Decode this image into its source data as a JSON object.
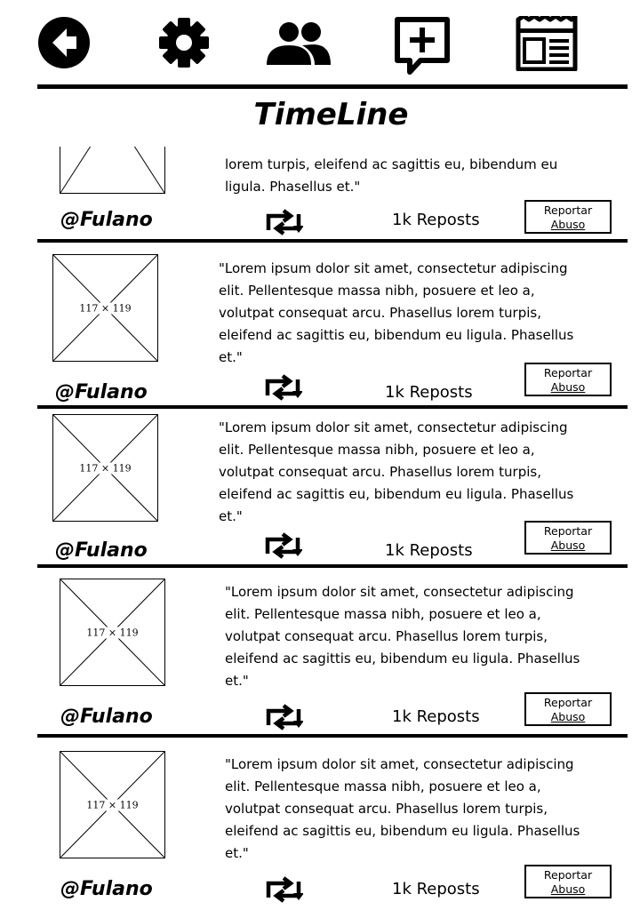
{
  "header": {
    "title": "TimeLine",
    "icons": [
      "back-icon",
      "gear-icon",
      "users-icon",
      "add-comment-icon",
      "newspaper-icon"
    ]
  },
  "placeholder_label": "117 × 119",
  "posts": [
    {
      "author": "@Fulano",
      "text": "lorem turpis, eleifend ac sagittis eu, bibendum eu ligula. Phasellus et.\"",
      "reposts": "1k Reposts",
      "report": {
        "line1": "Reportar",
        "line2": "Abuso"
      }
    },
    {
      "author": "@Fulano",
      "text": "\"Lorem ipsum dolor sit amet, consectetur adipiscing elit. Pellentesque massa nibh, posuere et leo a, volutpat consequat arcu. Phasellus lorem turpis, eleifend ac sagittis eu, bibendum eu ligula. Phasellus et.\"",
      "reposts": "1k Reposts",
      "report": {
        "line1": "Reportar",
        "line2": "Abuso"
      }
    },
    {
      "author": "@Fulano",
      "text": "\"Lorem ipsum dolor sit amet, consectetur adipiscing elit. Pellentesque massa nibh, posuere et leo a, volutpat consequat arcu. Phasellus lorem turpis, eleifend ac sagittis eu, bibendum eu ligula. Phasellus et.\"",
      "reposts": "1k Reposts",
      "report": {
        "line1": "Reportar",
        "line2": "Abuso"
      }
    },
    {
      "author": "@Fulano",
      "text": "\"Lorem ipsum dolor sit amet, consectetur adipiscing elit. Pellentesque massa nibh, posuere et leo a, volutpat consequat arcu. Phasellus lorem turpis, eleifend ac sagittis eu, bibendum eu ligula. Phasellus et.\"",
      "reposts": "1k Reposts",
      "report": {
        "line1": "Reportar",
        "line2": "Abuso"
      }
    },
    {
      "author": "@Fulano",
      "text": "\"Lorem ipsum dolor sit amet, consectetur adipiscing elit. Pellentesque massa nibh, posuere et leo a, volutpat consequat arcu. Phasellus lorem turpis, eleifend ac sagittis eu, bibendum eu ligula. Phasellus et.\"",
      "reposts": "1k Reposts",
      "report": {
        "line1": "Reportar",
        "line2": "Abuso"
      }
    }
  ]
}
